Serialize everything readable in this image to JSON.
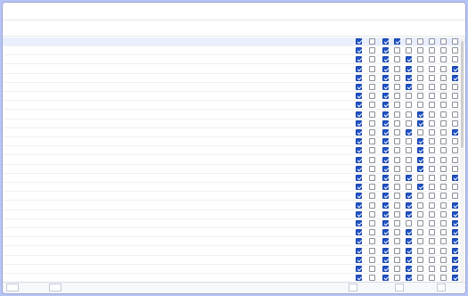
{
  "window": {
    "title": ""
  },
  "table": {
    "columns": {
      "ref": "",
      "old": "",
      "desc": "",
      "flags": [
        "",
        "",
        "",
        "",
        "",
        "",
        "",
        "",
        ""
      ]
    },
    "rows": [
      {
        "ref": "",
        "old": "",
        "desc": "",
        "checks": [
          1,
          0,
          1,
          1,
          0,
          0,
          0,
          0,
          0
        ]
      },
      {
        "ref": "",
        "old": "",
        "desc": "",
        "checks": [
          1,
          0,
          1,
          0,
          0,
          0,
          0,
          0,
          0
        ]
      },
      {
        "ref": "",
        "old": "",
        "desc": "",
        "checks": [
          1,
          0,
          1,
          0,
          1,
          0,
          0,
          0,
          0
        ]
      },
      {
        "ref": "",
        "old": "",
        "desc": "",
        "checks": [
          1,
          0,
          1,
          0,
          1,
          0,
          0,
          0,
          1
        ]
      },
      {
        "ref": "",
        "old": "",
        "desc": "",
        "checks": [
          1,
          0,
          1,
          0,
          1,
          0,
          0,
          0,
          1
        ]
      },
      {
        "ref": "",
        "old": "",
        "desc": "",
        "checks": [
          1,
          0,
          1,
          0,
          1,
          0,
          0,
          0,
          0
        ]
      },
      {
        "ref": "",
        "old": "",
        "desc": "",
        "checks": [
          1,
          0,
          1,
          0,
          0,
          0,
          0,
          0,
          0
        ]
      },
      {
        "ref": "",
        "old": "",
        "desc": "",
        "checks": [
          1,
          0,
          1,
          0,
          0,
          0,
          0,
          0,
          0
        ]
      },
      {
        "ref": "",
        "old": "",
        "desc": "",
        "checks": [
          1,
          0,
          1,
          0,
          0,
          1,
          0,
          0,
          0
        ]
      },
      {
        "ref": "",
        "old": "",
        "desc": "",
        "checks": [
          1,
          0,
          1,
          0,
          0,
          1,
          0,
          0,
          0
        ]
      },
      {
        "ref": "",
        "old": "",
        "desc": "",
        "checks": [
          1,
          0,
          1,
          0,
          1,
          0,
          0,
          0,
          1
        ]
      },
      {
        "ref": "",
        "old": "",
        "desc": "",
        "checks": [
          1,
          0,
          1,
          0,
          0,
          1,
          0,
          0,
          0
        ]
      },
      {
        "ref": "",
        "old": "",
        "desc": "",
        "checks": [
          1,
          0,
          1,
          0,
          0,
          1,
          0,
          0,
          0
        ]
      },
      {
        "ref": "",
        "old": "",
        "desc": "",
        "checks": [
          1,
          0,
          1,
          0,
          0,
          1,
          0,
          0,
          0
        ]
      },
      {
        "ref": "",
        "old": "",
        "desc": "",
        "checks": [
          1,
          0,
          1,
          0,
          0,
          1,
          0,
          0,
          0
        ]
      },
      {
        "ref": "",
        "old": "",
        "desc": "",
        "checks": [
          1,
          0,
          1,
          0,
          1,
          0,
          0,
          0,
          1
        ]
      },
      {
        "ref": "",
        "old": "",
        "desc": "",
        "checks": [
          1,
          0,
          1,
          0,
          0,
          1,
          0,
          0,
          0
        ]
      },
      {
        "ref": "",
        "old": "",
        "desc": "",
        "checks": [
          1,
          0,
          1,
          0,
          1,
          0,
          0,
          0,
          0
        ]
      },
      {
        "ref": "",
        "old": "",
        "desc": "",
        "checks": [
          1,
          0,
          1,
          0,
          1,
          0,
          0,
          0,
          1
        ]
      },
      {
        "ref": "",
        "old": "",
        "desc": "",
        "checks": [
          1,
          0,
          1,
          0,
          1,
          0,
          0,
          0,
          1
        ]
      },
      {
        "ref": "",
        "old": "",
        "desc": "",
        "checks": [
          1,
          0,
          1,
          0,
          0,
          0,
          0,
          0,
          1
        ]
      },
      {
        "ref": "",
        "old": "",
        "desc": "",
        "checks": [
          1,
          0,
          1,
          0,
          1,
          0,
          0,
          0,
          1
        ]
      },
      {
        "ref": "",
        "old": "",
        "desc": "",
        "checks": [
          1,
          0,
          1,
          0,
          1,
          0,
          0,
          0,
          1
        ]
      },
      {
        "ref": "",
        "old": "",
        "desc": "",
        "checks": [
          1,
          0,
          1,
          0,
          1,
          0,
          0,
          0,
          1
        ]
      },
      {
        "ref": "",
        "old": "",
        "desc": "",
        "checks": [
          1,
          0,
          1,
          0,
          1,
          0,
          0,
          0,
          1
        ]
      },
      {
        "ref": "",
        "old": "",
        "desc": "",
        "checks": [
          1,
          0,
          1,
          0,
          1,
          0,
          0,
          0,
          1
        ]
      },
      {
        "ref": "",
        "old": "",
        "desc": "",
        "checks": [
          1,
          0,
          1,
          0,
          1,
          0,
          0,
          0,
          1
        ]
      }
    ]
  },
  "footer": {
    "tab1": "",
    "tab2": "",
    "btn1": "",
    "btn2": "",
    "btn3": ""
  },
  "colors": {
    "accent": "#1f52c7",
    "background": "#b7c4f5"
  }
}
